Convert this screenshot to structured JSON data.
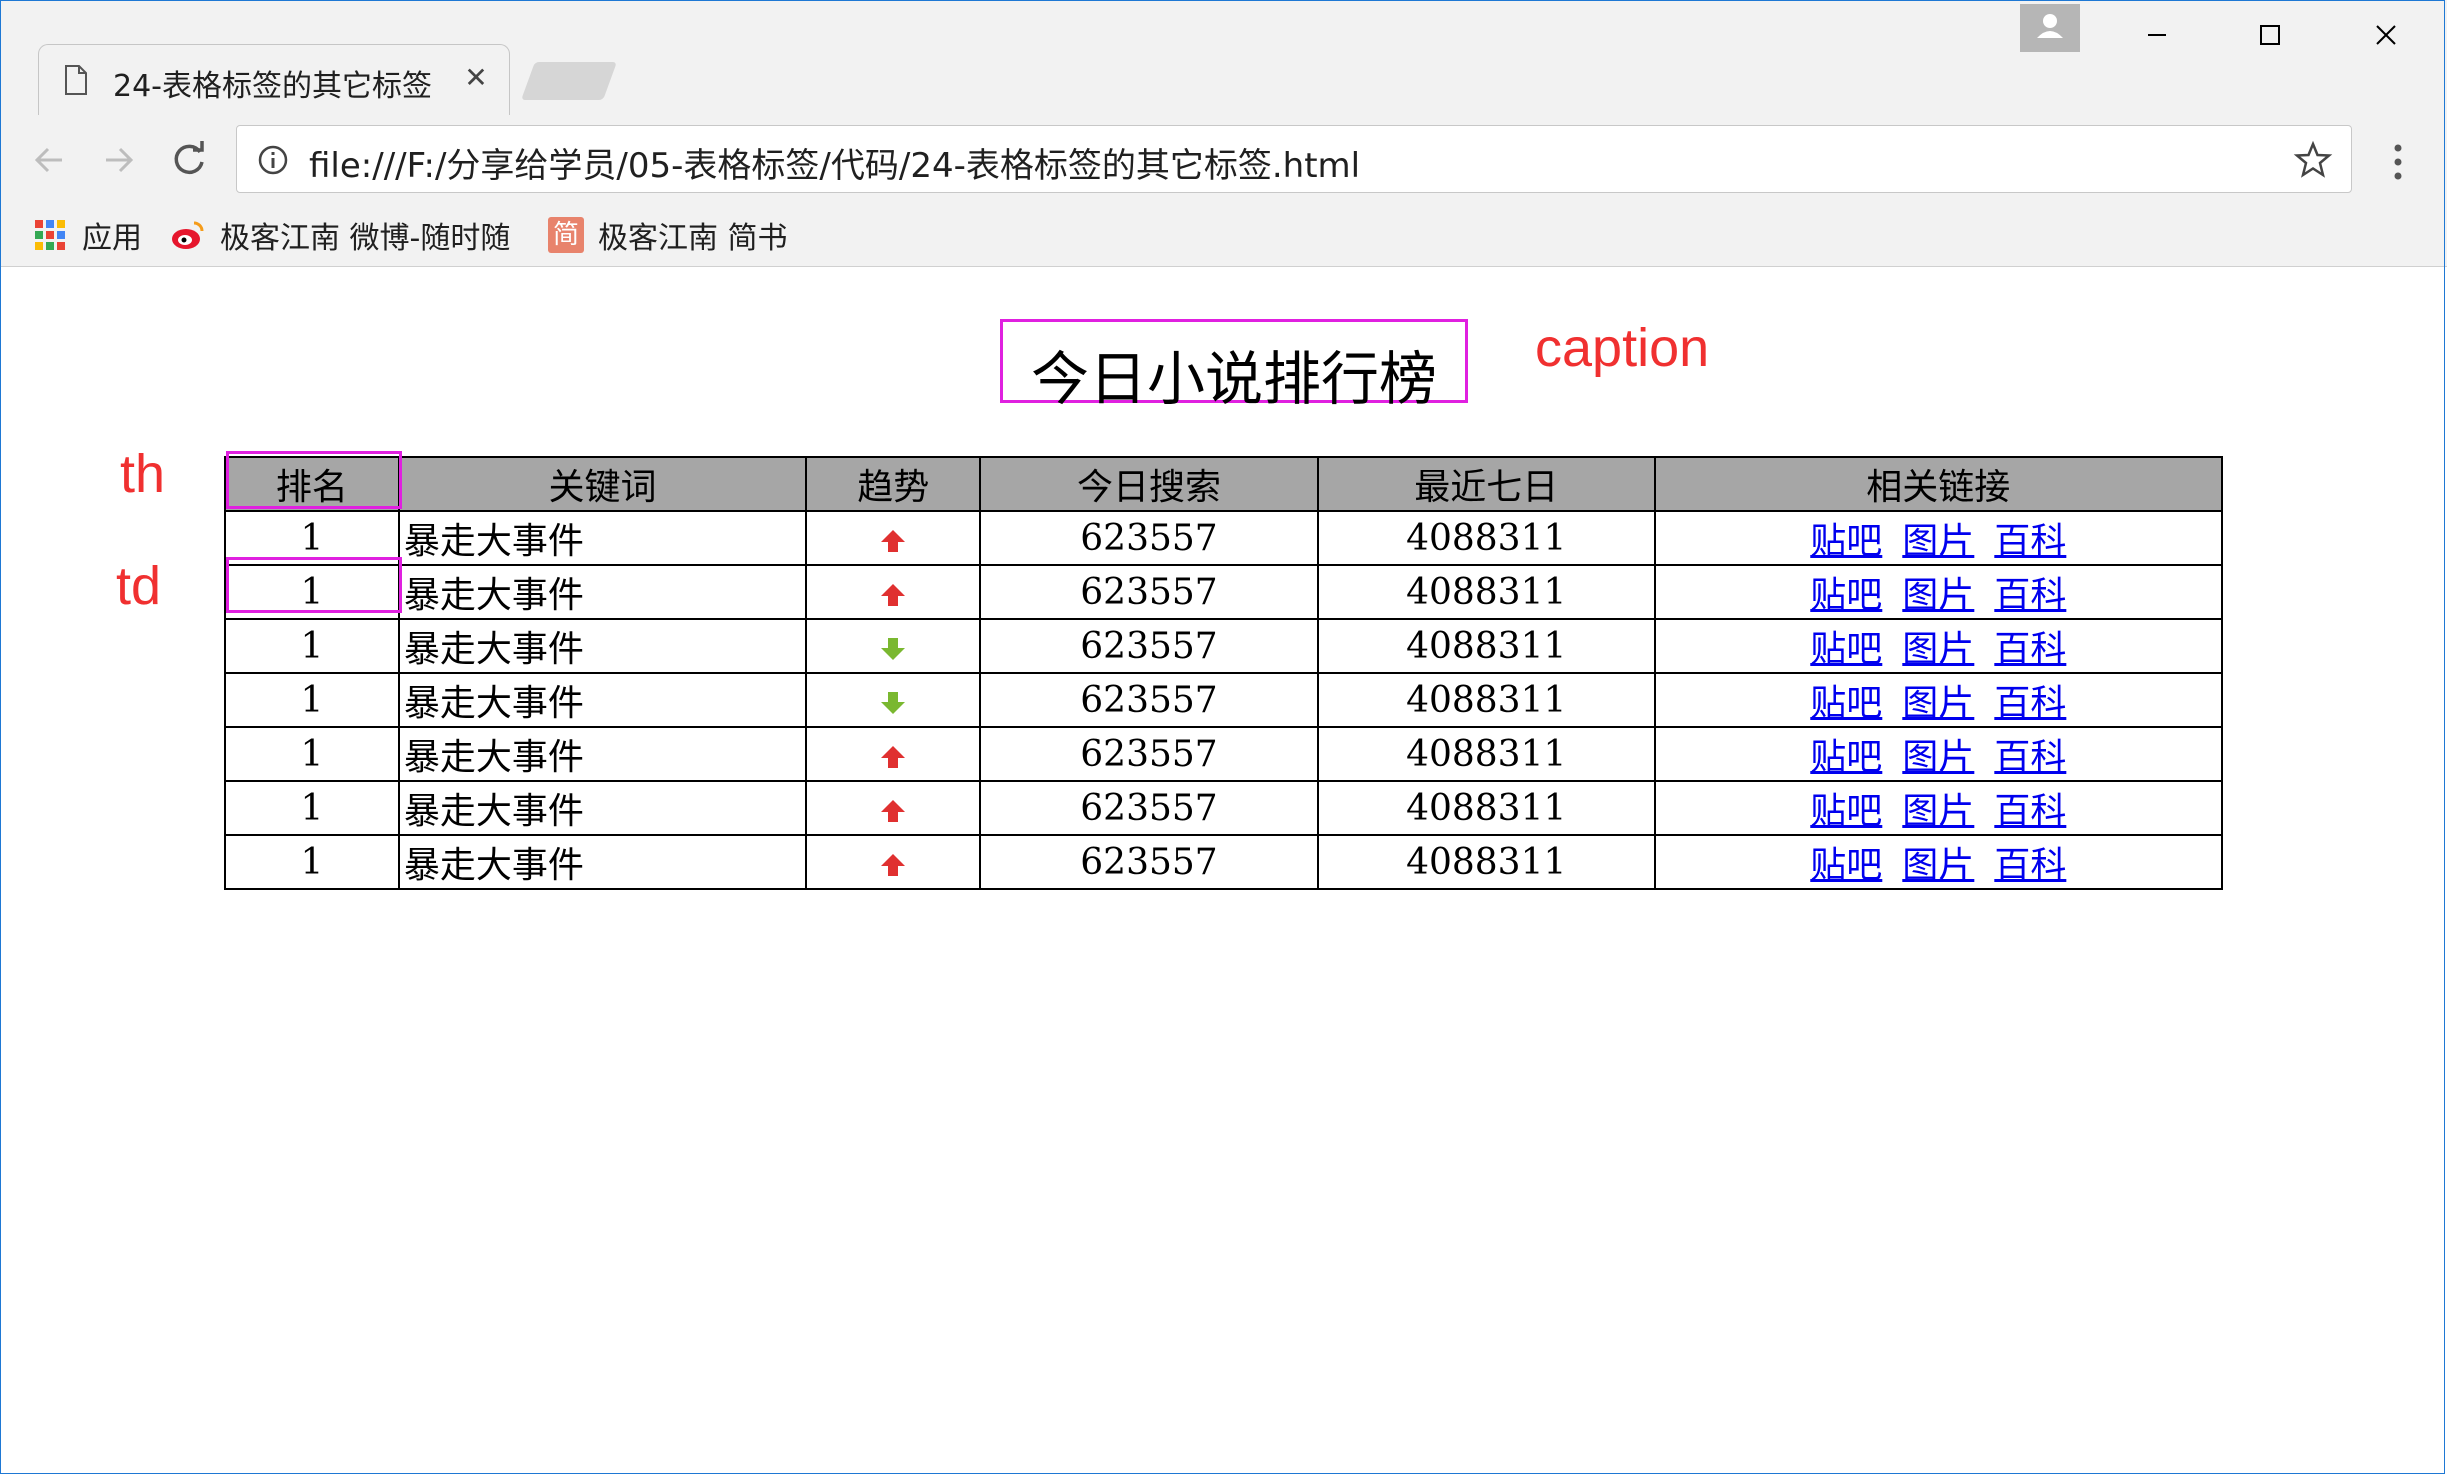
{
  "browser": {
    "tab_title": "24-表格标签的其它标签",
    "url": "file:///F:/分享给学员/05-表格标签/代码/24-表格标签的其它标签.html",
    "bookmarks": [
      {
        "label": "应用",
        "icon": "apps-grid-icon"
      },
      {
        "label": "极客江南 微博-随时随",
        "icon": "weibo-icon"
      },
      {
        "label": "极客江南 简书",
        "icon": "jianshu-icon",
        "icon_text": "简"
      }
    ]
  },
  "page": {
    "caption": "今日小说排行榜",
    "annotations": {
      "caption": "caption",
      "th": "th",
      "td": "td"
    },
    "table": {
      "headers": [
        "排名",
        "关键词",
        "趋势",
        "今日搜索",
        "最近七日",
        "相关链接"
      ],
      "rows": [
        {
          "rank": "1",
          "keyword": "暴走大事件",
          "trend": "up",
          "today": "623557",
          "week": "4088311"
        },
        {
          "rank": "1",
          "keyword": "暴走大事件",
          "trend": "up",
          "today": "623557",
          "week": "4088311"
        },
        {
          "rank": "1",
          "keyword": "暴走大事件",
          "trend": "down",
          "today": "623557",
          "week": "4088311"
        },
        {
          "rank": "1",
          "keyword": "暴走大事件",
          "trend": "down",
          "today": "623557",
          "week": "4088311"
        },
        {
          "rank": "1",
          "keyword": "暴走大事件",
          "trend": "up",
          "today": "623557",
          "week": "4088311"
        },
        {
          "rank": "1",
          "keyword": "暴走大事件",
          "trend": "up",
          "today": "623557",
          "week": "4088311"
        },
        {
          "rank": "1",
          "keyword": "暴走大事件",
          "trend": "up",
          "today": "623557",
          "week": "4088311"
        }
      ],
      "links": [
        "贴吧",
        "图片",
        "百科"
      ]
    }
  },
  "colors": {
    "header_bg": "#a6a6a6",
    "link": "#0000ee",
    "annotation": "#f03030",
    "highlight": "#e020e0",
    "trend_up": "#e03030",
    "trend_down": "#7ab830"
  }
}
